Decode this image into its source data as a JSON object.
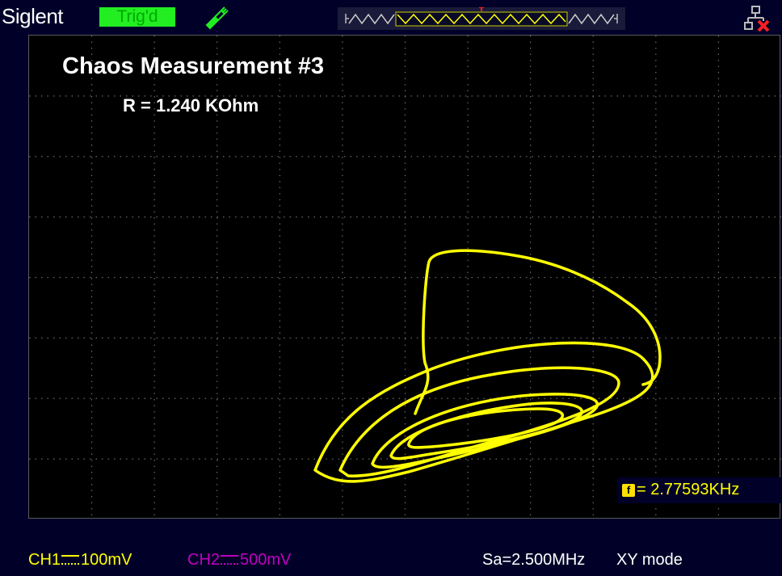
{
  "header": {
    "brand": "Siglent",
    "trigger_status": "Trig'd",
    "trigger_status_color": "#22ee22",
    "icons": [
      "probe-icon",
      "trigger-position-marker",
      "network-disconnected-icon"
    ],
    "trigger_marker": "T"
  },
  "screen": {
    "title": "Chaos Measurement #3",
    "subtitle": "R = 1.240 KOhm",
    "trace_color": "#ffff00",
    "frequency_counter": {
      "badge": "f",
      "value": "= 2.77593KHz"
    }
  },
  "status": {
    "ch1_label": "CH1",
    "ch1_scale": "100mV",
    "ch1_color": "#ffff00",
    "ch2_label": "CH2",
    "ch2_scale": "500mV",
    "ch2_color": "#c000c0",
    "sample_rate": "Sa=2.500MHz",
    "mode": "XY mode"
  }
}
